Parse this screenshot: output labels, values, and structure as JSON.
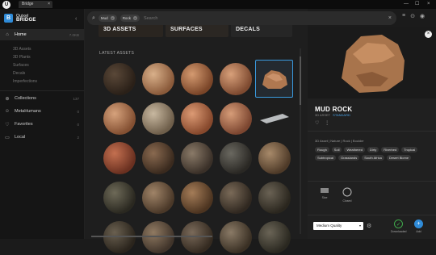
{
  "window": {
    "logo": "U",
    "tab_label": "Bridge",
    "tab_close": "×",
    "controls": [
      "—",
      "☐",
      "×"
    ]
  },
  "sidebar": {
    "brand_top": "Quixel",
    "brand_bottom": "BRIDGE",
    "collapse": "‹",
    "home": {
      "label": "Home",
      "count": "7.0KB"
    },
    "sub_items": [
      "3D Assets",
      "3D Plants",
      "Surfaces",
      "Decals",
      "Imperfections"
    ],
    "collections": {
      "label": "Collections",
      "count": "137"
    },
    "metahumans": {
      "label": "MetaHumans",
      "count": "0"
    },
    "favorites": {
      "label": "Favorites",
      "count": "0"
    },
    "local": {
      "label": "Local",
      "count": "2"
    }
  },
  "search": {
    "chips": [
      "Mud",
      "Rock"
    ],
    "placeholder": "Search",
    "clear": "×"
  },
  "categories": [
    "3D ASSETS",
    "SURFACES",
    "DECALS"
  ],
  "main": {
    "section_title": "LATEST ASSETS"
  },
  "asset": {
    "title": "MUD ROCK",
    "type": "3D ASSET",
    "license": "STANDARD",
    "breadcrumb": "3D Asset  |  Nature  |  Rock  |  Boulder",
    "tags": [
      "Rough",
      "Soil",
      "Weathered",
      "Dirty",
      "Riverbed",
      "Tropical",
      "Subtropical",
      "Grasslands",
      "South Africa",
      "Desert Biome"
    ],
    "variants": [
      {
        "label": "Size"
      },
      {
        "label": "Closed"
      }
    ],
    "quality": "Medium Quality",
    "downloaded_label": "Downloaded",
    "add_label": "Add"
  },
  "colors": {
    "accent": "#2f8bd8",
    "selected_border": "#3a9be0",
    "downloaded": "#3fa84a"
  }
}
